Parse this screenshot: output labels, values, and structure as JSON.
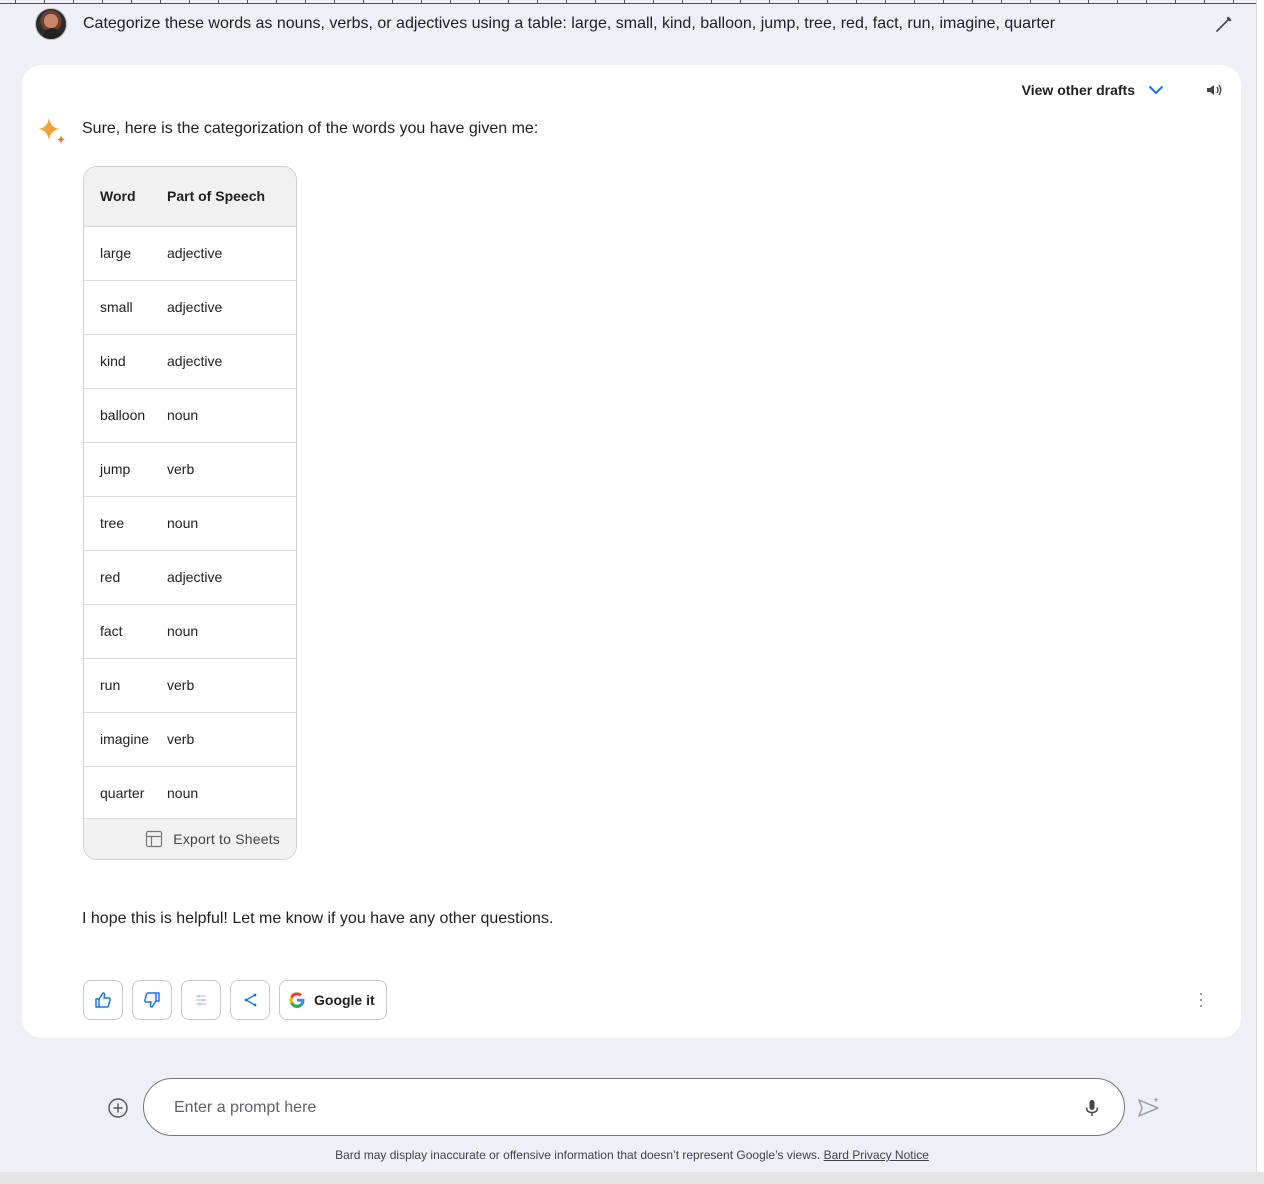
{
  "prompt": {
    "text": "Categorize these words as nouns, verbs, or adjectives using a table: large, small, kind, balloon, jump, tree, red, fact, run, imagine, quarter"
  },
  "response": {
    "drafts_label": "View other drafts",
    "intro": "Sure, here is the categorization of the words you have given me:",
    "table": {
      "headers": [
        "Word",
        "Part of Speech"
      ],
      "rows": [
        [
          "large",
          "adjective"
        ],
        [
          "small",
          "adjective"
        ],
        [
          "kind",
          "adjective"
        ],
        [
          "balloon",
          "noun"
        ],
        [
          "jump",
          "verb"
        ],
        [
          "tree",
          "noun"
        ],
        [
          "red",
          "adjective"
        ],
        [
          "fact",
          "noun"
        ],
        [
          "run",
          "verb"
        ],
        [
          "imagine",
          "verb"
        ],
        [
          "quarter",
          "noun"
        ]
      ],
      "export_label": "Export to Sheets"
    },
    "outro": "I hope this is helpful! Let me know if you have any other questions.",
    "actions": {
      "google_label": "Google it"
    }
  },
  "input": {
    "placeholder": "Enter a prompt here",
    "value": ""
  },
  "footer": {
    "disclaimer": "Bard may display inaccurate or offensive information that doesn’t represent Google’s views.",
    "privacy_link": "Bard Privacy Notice"
  },
  "colors": {
    "accent_blue": "#1a73e8",
    "background": "#eef0f6",
    "card": "#ffffff"
  },
  "icons": [
    "edit-icon",
    "chevron-down-icon",
    "speaker-icon",
    "sparkle-icon",
    "sheets-icon",
    "thumbs-up-icon",
    "thumbs-down-icon",
    "tune-icon",
    "share-icon",
    "google-icon",
    "more-vert-icon",
    "add-circle-icon",
    "mic-icon",
    "send-icon"
  ]
}
